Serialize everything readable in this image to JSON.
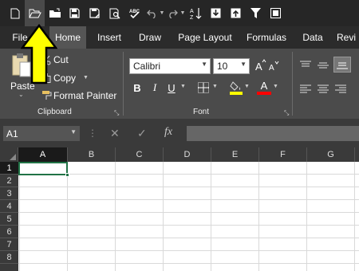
{
  "quick_access": {
    "icons": [
      "new-file-icon",
      "open-folder-icon",
      "open-icon",
      "save-icon",
      "save-as-icon",
      "print-preview-icon",
      "spelling-icon",
      "undo-icon",
      "redo-icon",
      "sort-icon",
      "download-icon",
      "upload-icon",
      "filter-icon",
      "more-icon"
    ]
  },
  "tabs": [
    "File",
    "Home",
    "Insert",
    "Draw",
    "Page Layout",
    "Formulas",
    "Data",
    "Revi"
  ],
  "selected_tab": "Home",
  "clipboard": {
    "paste": "Paste",
    "cut": "Cut",
    "copy": "Copy",
    "format_painter": "Format Painter",
    "group_label": "Clipboard"
  },
  "font": {
    "name": "Calibri",
    "size": "10",
    "bold": "B",
    "italic": "I",
    "underline": "U",
    "font_color_letter": "A",
    "group_label": "Font",
    "highlight_color": "#ffff00",
    "font_color": "#ff0000"
  },
  "formula_bar": {
    "name_box": "A1",
    "cancel": "✕",
    "enter": "✓",
    "fx": "fx",
    "value": ""
  },
  "columns": [
    "A",
    "B",
    "C",
    "D",
    "E",
    "F",
    "G"
  ],
  "rows": [
    "1",
    "2",
    "3",
    "4",
    "5",
    "6",
    "7",
    "8"
  ],
  "selected_cell": "A1",
  "accent": "#217346",
  "arrow_color": "#ffff00"
}
